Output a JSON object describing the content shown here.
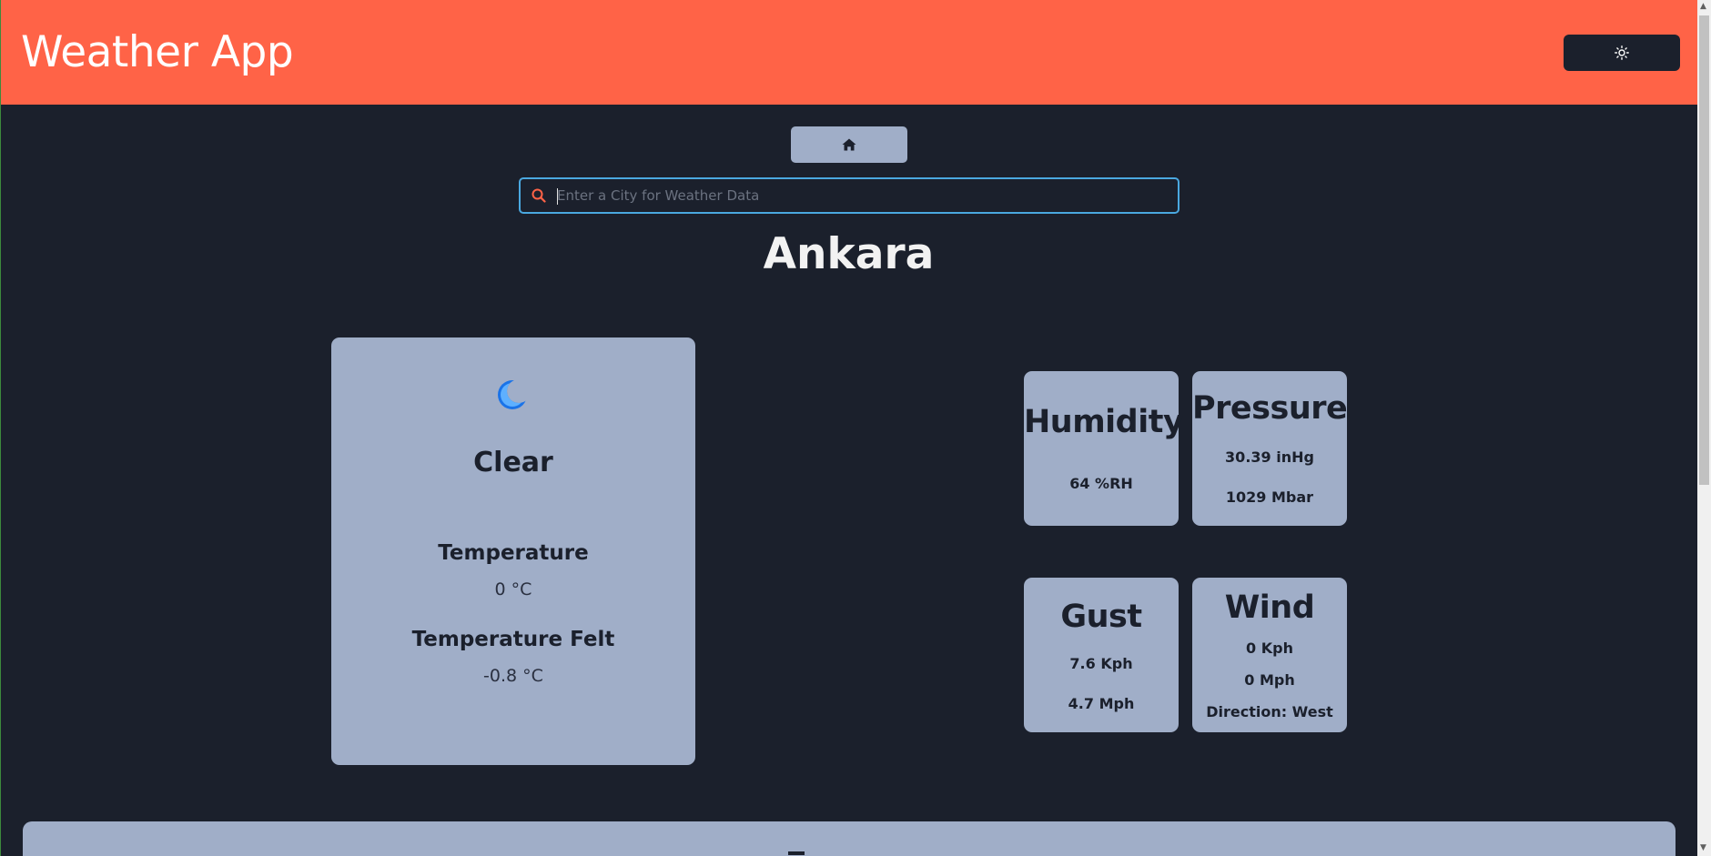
{
  "header": {
    "title": "Weather App",
    "theme_toggle_icon": "sun-icon"
  },
  "nav": {
    "home_icon": "home-icon"
  },
  "search": {
    "placeholder": "Enter a City for Weather Data",
    "value": "",
    "icon": "search-icon"
  },
  "city": "Ankara",
  "current": {
    "icon": "moon-icon",
    "condition": "Clear",
    "temperature_label": "Temperature",
    "temperature_value": "0 °C",
    "felt_label": "Temperature Felt",
    "felt_value": "-0.8 °C"
  },
  "humidity": {
    "title": "Humidity",
    "value": "64 %RH"
  },
  "pressure": {
    "title": "Pressure",
    "inhg": "30.39 inHg",
    "mbar": "1029 Mbar"
  },
  "gust": {
    "title": "Gust",
    "kph": "7.6 Kph",
    "mph": "4.7 Mph"
  },
  "wind": {
    "title": "Wind",
    "kph": "0 Kph",
    "mph": "0 Mph",
    "direction": "Direction: West"
  },
  "colors": {
    "header": "#ff6347",
    "background": "#1b202c",
    "card": "#a0aec8",
    "search_border": "#4aa8e0",
    "moon": "#1a73e8"
  }
}
